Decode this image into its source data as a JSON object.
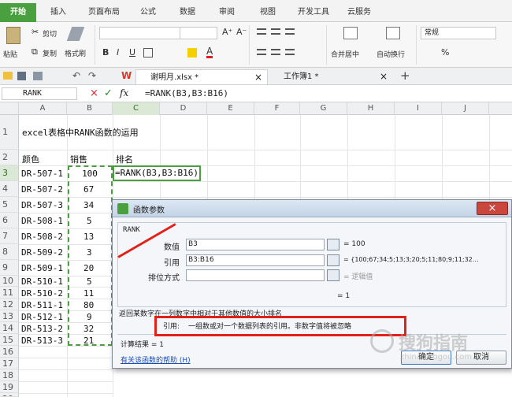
{
  "ribbon_tabs": [
    "开始",
    "插入",
    "页面布局",
    "公式",
    "数据",
    "审阅",
    "视图",
    "开发工具",
    "云服务"
  ],
  "ribbon": {
    "paste": "粘贴",
    "cut": "剪切",
    "copy": "复制",
    "format_painter": "格式刷",
    "bold": "B",
    "italic": "I",
    "underline": "U",
    "merge_center": "合并居中",
    "auto_wrap": "自动换行",
    "number_format": "常规",
    "percent": "%",
    "font_grow": "A⁺",
    "font_shrink": "A⁻"
  },
  "doc_tabs": [
    {
      "label": "谢明月.xlsx *",
      "close": "×"
    },
    {
      "label": "工作簿1 *",
      "close": "×"
    }
  ],
  "doc_add": "+",
  "formula_bar": {
    "name_box": "RANK",
    "cancel": "×",
    "confirm": "✓",
    "fx": "fx",
    "content": "=RANK(B3,B3:B16)"
  },
  "columns": [
    "A",
    "B",
    "C",
    "D",
    "E",
    "F",
    "G",
    "H",
    "I",
    "J"
  ],
  "rows": [
    "1",
    "2",
    "3",
    "4",
    "5",
    "6",
    "7",
    "8",
    "9",
    "10",
    "11",
    "12",
    "13",
    "14",
    "15",
    "16",
    "17",
    "18",
    "19",
    "20"
  ],
  "sheet": {
    "title": "excel表格中RANK函数的运用",
    "header_a": "颜色",
    "header_b": "销售",
    "header_c": "排名",
    "c3": "=RANK(B3,B3:B16)",
    "colors": [
      "DR-507-1",
      "DR-507-2",
      "DR-507-3",
      "DR-508-1",
      "DR-508-2",
      "DR-509-2",
      "DR-509-1",
      "DR-510-1",
      "DR-510-2",
      "DR-511-1",
      "DR-512-1",
      "DR-513-2",
      "DR-513-3"
    ],
    "sales": [
      "100",
      "67",
      "34",
      "5",
      "13",
      "3",
      "20",
      "5",
      "11",
      "80",
      "9",
      "32",
      "21"
    ]
  },
  "dialog": {
    "title": "函数参数",
    "close": "×",
    "func_name": "RANK",
    "arg1_label": "数值",
    "arg1_value": "B3",
    "arg1_result": "= 100",
    "arg2_label": "引用",
    "arg2_value": "B3:B16",
    "arg2_result": "= {100;67;34;5;13;3;20;5;11;80;9;11;32…",
    "arg3_label": "排位方式",
    "arg3_value": "",
    "arg3_result": "= 逻辑值",
    "total_result": "= 1",
    "description": "返回某数字在一列数字中相对于其他数值的大小排名",
    "arg_help_label": "引用:",
    "arg_help_text": "一组数或对一个数据列表的引用。非数字值将被忽略",
    "calc_result": "计算结果 = 1",
    "help_link": "有关该函数的帮助 (H)",
    "ok": "确定",
    "cancel": "取消"
  },
  "watermark": {
    "brand": "搜狗指南",
    "url": "zhinan.sogou.com"
  },
  "colors": {
    "accent_green": "#4a9f3e",
    "highlight_red": "#e0221b",
    "link_blue": "#1a4fb5"
  }
}
